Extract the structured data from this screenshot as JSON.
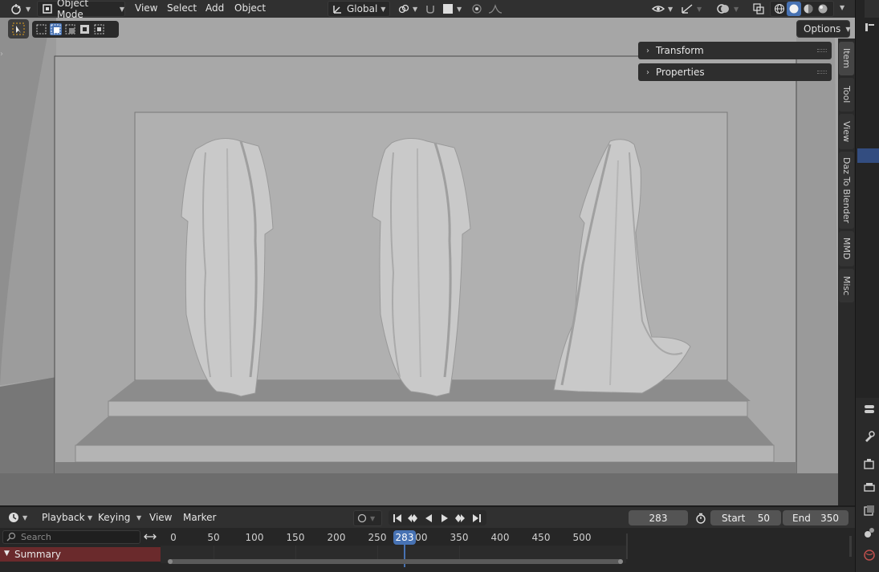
{
  "header": {
    "mode": "Object Mode",
    "menus": [
      "View",
      "Select",
      "Add",
      "Object"
    ],
    "transform_orientation": "Global"
  },
  "toolbar": {
    "options_label": "Options"
  },
  "n_panel": {
    "sections": [
      "Transform",
      "Properties"
    ],
    "tabs": [
      "Item",
      "Tool",
      "View",
      "Daz To Blender",
      "MMD",
      "Misc"
    ],
    "active_tab": "Item"
  },
  "timeline": {
    "menus": [
      "Playback",
      "Keying",
      "View",
      "Marker"
    ],
    "current_frame": "283",
    "start_label": "Start",
    "start_value": "50",
    "end_label": "End",
    "end_value": "350",
    "search_placeholder": "Search",
    "summary_label": "Summary",
    "ticks": [
      "0",
      "50",
      "100",
      "150",
      "200",
      "250",
      "300",
      "350",
      "400",
      "450",
      "500"
    ],
    "playhead_label": "283"
  },
  "colors": {
    "accent": "#4772b3",
    "summary_bg": "#6a2a2c",
    "viewport_bg": "#a9a9a9"
  },
  "icons": [
    "editor-type-icon",
    "object-mode-icon",
    "global-orientation-icon",
    "pivot-icon",
    "snap-icon",
    "proportional-edit-icon",
    "visibility-icon",
    "gizmo-icon",
    "overlay-icon",
    "xray-icon",
    "wireframe-shading-icon",
    "solid-shading-icon",
    "material-shading-icon",
    "rendered-shading-icon",
    "select-box-icon",
    "jump-start-icon",
    "keyframe-prev-icon",
    "play-reverse-icon",
    "play-icon",
    "keyframe-next-icon",
    "jump-end-icon",
    "stopwatch-icon"
  ]
}
